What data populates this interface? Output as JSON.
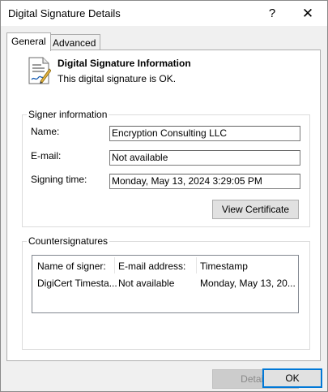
{
  "window": {
    "title": "Digital Signature Details",
    "help_glyph": "?",
    "close_glyph": "✕"
  },
  "tabs": [
    {
      "label": "General"
    },
    {
      "label": "Advanced"
    }
  ],
  "info": {
    "heading": "Digital Signature Information",
    "status": "This digital signature is OK."
  },
  "signer": {
    "legend": "Signer information",
    "name_label": "Name:",
    "name_value": "Encryption Consulting LLC",
    "email_label": "E-mail:",
    "email_value": "Not available",
    "time_label": "Signing time:",
    "time_value": "Monday, May 13, 2024 3:29:05 PM",
    "view_certificate": "View Certificate"
  },
  "countersignatures": {
    "legend": "Countersignatures",
    "columns": [
      "Name of signer:",
      "E-mail address:",
      "Timestamp"
    ],
    "rows": [
      [
        "DigiCert Timesta...",
        "Not available",
        "Monday, May 13, 20..."
      ]
    ],
    "details": "Details"
  },
  "footer": {
    "ok": "OK"
  }
}
